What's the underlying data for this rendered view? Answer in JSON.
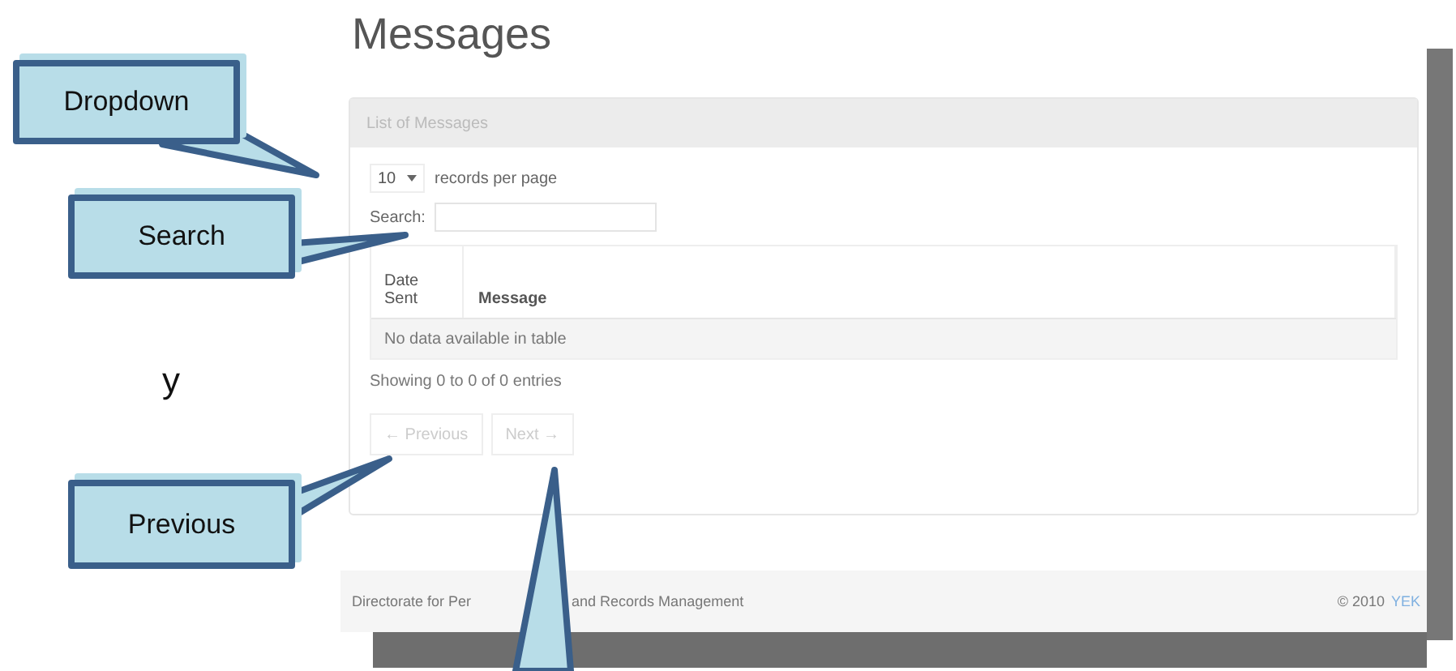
{
  "document": {
    "stray_text": "y"
  },
  "app": {
    "title": "Messages",
    "panel_title": "List of Messages",
    "page_size": "10",
    "page_size_label": "records per page",
    "search_label": "Search:",
    "columns": [
      "Date Sent",
      "Message"
    ],
    "empty_message": "No data available in table",
    "info": "Showing 0 to 0 of 0 entries",
    "pager": [
      {
        "label": "← Previous",
        "disabled": true
      },
      {
        "label": "Next →",
        "disabled": true
      }
    ],
    "footer": {
      "left": [
        "Directorate for Per",
        "and Records Management"
      ],
      "copyright": "© 2010",
      "link": "YEK"
    }
  },
  "callouts": [
    {
      "kind": "box",
      "label": "Dropdown"
    },
    {
      "kind": "box",
      "label": "Search"
    },
    {
      "kind": "box",
      "label": "Previous"
    },
    {
      "kind": "pointer"
    }
  ]
}
